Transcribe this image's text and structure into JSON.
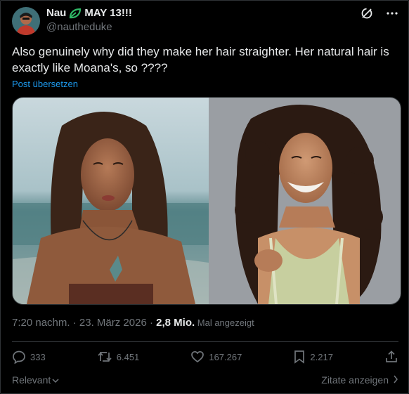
{
  "author": {
    "name": "Nau",
    "name_suffix": "MAY 13!!!",
    "handle": "@nautheduke",
    "avatar_icon": "avatar-icon",
    "leaf_color": "#2fb866"
  },
  "tweet": {
    "text": "Also genuinely why did they make her hair straighter. Her natural hair is exactly like Moana's, so ????",
    "translate_label": "Post übersetzen"
  },
  "meta": {
    "time": "7:20 nachm.",
    "sep1": " · ",
    "date": "23. März 2026",
    "sep2": " · ",
    "views": "2,8 Mio.",
    "views_label": " Mal angezeigt"
  },
  "actions": {
    "replies": "333",
    "reposts": "6.451",
    "likes": "167.267",
    "bookmarks": "2.217"
  },
  "footer": {
    "sort_label": "Relevant",
    "quotes_label": "Zitate anzeigen"
  },
  "colors": {
    "background": "#000000",
    "text": "#e7e9ea",
    "muted": "#71767b",
    "link": "#1d9bf0",
    "border": "#2f3336"
  }
}
